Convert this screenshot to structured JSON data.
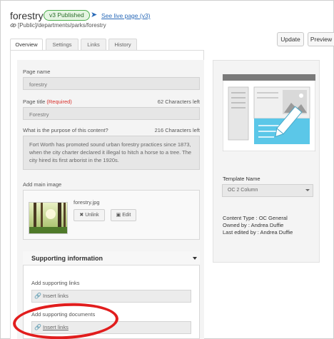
{
  "header": {
    "page_name": "forestry",
    "status_badge": "v3 Published",
    "live_link": "See live page (v3)",
    "page_path": "[Public]/departments/parks/forestry"
  },
  "tabs": [
    {
      "label": "Overview",
      "active": true
    },
    {
      "label": "Settings",
      "active": false
    },
    {
      "label": "Links",
      "active": false
    },
    {
      "label": "History",
      "active": false
    }
  ],
  "actions": {
    "update_label": "Update",
    "preview_label": "Preview"
  },
  "form": {
    "page_name_label": "Page name",
    "page_name_value": "forestry",
    "page_title_label": "Page title",
    "page_title_required": "(Required)",
    "page_title_counter": "62 Characters left",
    "page_title_value": "Forestry",
    "purpose_label": "What is the purpose of this content?",
    "purpose_counter": "216 Characters left",
    "purpose_value": "Fort Worth has promoted sound urban forestry practices since 1873, when the city charter declared it illegal to hitch a horse to a tree. The city hired its first arborist in the 1920s.",
    "main_image_label": "Add main image",
    "image_file_name": "forestry.jpg",
    "unlink_label": "Unlink",
    "edit_label": "Edit"
  },
  "supporting": {
    "title": "Supporting information",
    "links_label": "Add supporting links",
    "links_placeholder": "Insert links",
    "docs_label": "Add supporting documents",
    "docs_placeholder": "Insert links"
  },
  "sidebar": {
    "template_label": "Template Name",
    "template_value": "OC 2 Column",
    "content_type": "Content Type : OC General",
    "owned_by": "Owned by : Andrea Duffie",
    "last_edited": "Last edited by : Andrea Duffie"
  },
  "colors": {
    "badge_green": "#4cae4c",
    "link_blue": "#2a6ab8",
    "required_red": "#d9302c",
    "annotation_red": "#e11d1d",
    "template_accent": "#5bc7e8"
  },
  "icons": [
    "arrow-icon",
    "link-chain-icon",
    "unlink-icon",
    "image-edit-icon",
    "chevron-down-icon"
  ]
}
